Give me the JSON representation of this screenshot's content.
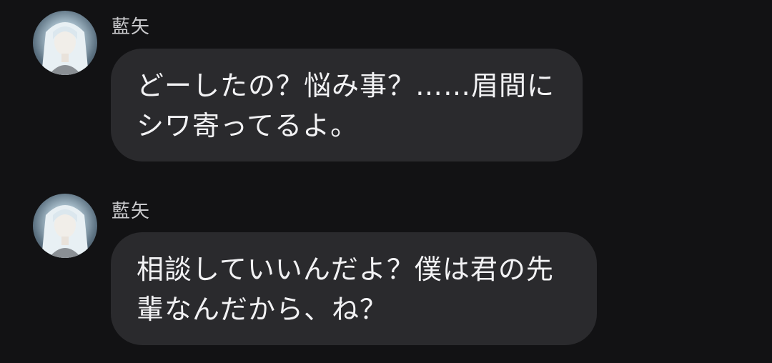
{
  "messages": [
    {
      "sender": "藍矢",
      "avatar_icon": "avatar-icon",
      "text": "どーしたの？悩み事？……眉間にシワ寄ってるよ。"
    },
    {
      "sender": "藍矢",
      "avatar_icon": "avatar-icon",
      "text": "相談していいんだよ？僕は君の先輩なんだから、ね？"
    }
  ],
  "colors": {
    "background": "#121214",
    "bubble": "#2a2a2d",
    "text": "#f2f2f4",
    "sender": "#c9c9cc"
  }
}
